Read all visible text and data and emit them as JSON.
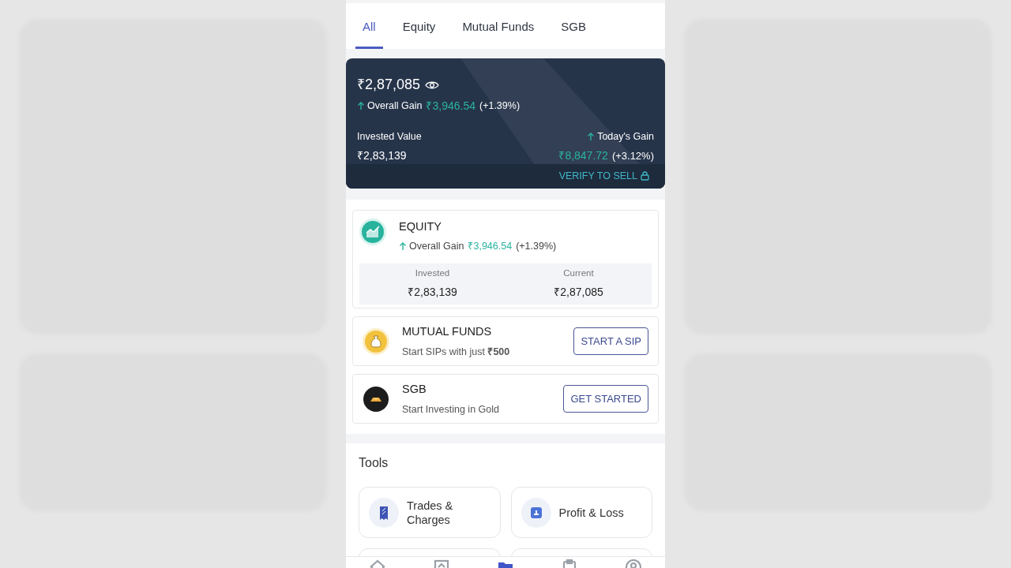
{
  "tabs": [
    {
      "label": "All",
      "selected": true
    },
    {
      "label": "Equity",
      "selected": false
    },
    {
      "label": "Mutual Funds",
      "selected": false
    },
    {
      "label": "SGB",
      "selected": false
    }
  ],
  "summary": {
    "total": "₹2,87,085",
    "gain_label": "Overall Gain",
    "gain_value": "₹3,946.54",
    "gain_pct": "(+1.39%)",
    "invested_label": "Invested Value",
    "invested_value": "₹2,83,139",
    "today_label": "Today's Gain",
    "today_value": "₹8,847.72",
    "today_pct": "(+3.12%)",
    "action": "VERIFY TO SELL"
  },
  "equity": {
    "title": "EQUITY",
    "gain_label": "Overall Gain",
    "gain_value": "₹3,946.54",
    "gain_pct": "(+1.39%)",
    "invested_label": "Invested",
    "invested_value": "₹2,83,139",
    "current_label": "Current",
    "current_value": "₹2,87,085"
  },
  "products": [
    {
      "kind": "mutual",
      "title": "MUTUAL FUNDS",
      "subtitle": "Start SIPs with just **₹500**",
      "button": "START A SIP"
    },
    {
      "kind": "gold",
      "title": "SGB",
      "subtitle": "Start Investing in Gold",
      "button": "GET STARTED"
    }
  ],
  "tools": {
    "title": "Tools",
    "items": [
      {
        "kind": "trades",
        "label": "Trades & Charges"
      },
      {
        "kind": "pnl",
        "label": "Profit & Loss"
      }
    ]
  },
  "bottom_nav": [
    {
      "kind": "home",
      "selected": false
    },
    {
      "kind": "chart",
      "selected": false
    },
    {
      "kind": "folder",
      "selected": true
    },
    {
      "kind": "clipboard",
      "selected": false
    },
    {
      "kind": "profile",
      "selected": false
    }
  ]
}
